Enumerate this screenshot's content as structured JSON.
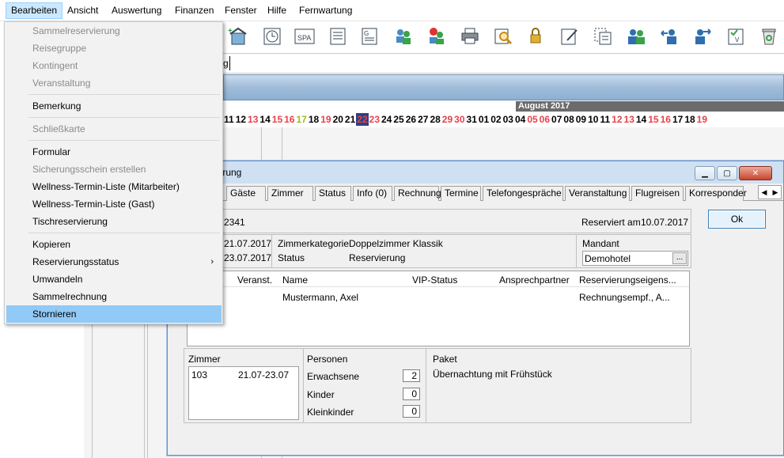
{
  "menubar": {
    "items": [
      "Bearbeiten",
      "Ansicht",
      "Auswertung",
      "Finanzen",
      "Fenster",
      "Hilfe",
      "Fernwartung"
    ]
  },
  "toolbar": {
    "spa_label": "SPA"
  },
  "addr": {
    "value": "g"
  },
  "calendar": {
    "month": "August 2017",
    "days": [
      "11",
      "12",
      "13",
      "14",
      "15",
      "16",
      "17",
      "18",
      "19",
      "20",
      "21",
      "22",
      "23",
      "24",
      "25",
      "26",
      "27",
      "28",
      "29",
      "30",
      "31",
      "01",
      "02",
      "03",
      "04",
      "05",
      "06",
      "07",
      "08",
      "09",
      "10",
      "11",
      "12",
      "13",
      "14",
      "15",
      "16",
      "17",
      "18",
      "19"
    ]
  },
  "context_menu": {
    "items": [
      {
        "label": "Sammelreservierung",
        "disabled": true
      },
      {
        "label": "Reisegruppe",
        "disabled": true
      },
      {
        "label": "Kontingent",
        "disabled": true
      },
      {
        "label": "Veranstaltung",
        "disabled": true
      },
      {
        "label": "Bemerkung",
        "disabled": false
      },
      {
        "label": "Schließkarte",
        "disabled": true
      },
      {
        "label": "Formular",
        "disabled": false
      },
      {
        "label": "Sicherungsschein erstellen",
        "disabled": true
      },
      {
        "label": "Wellness-Termin-Liste (Mitarbeiter)",
        "disabled": false
      },
      {
        "label": "Wellness-Termin-Liste (Gast)",
        "disabled": false
      },
      {
        "label": "Tischreservierung",
        "disabled": false
      },
      {
        "label": "Kopieren",
        "disabled": false
      },
      {
        "label": "Reservierungsstatus",
        "disabled": false,
        "submenu": true
      },
      {
        "label": "Umwandeln",
        "disabled": false
      },
      {
        "label": "Sammelrechnung",
        "disabled": false
      },
      {
        "label": "Stornieren",
        "disabled": false,
        "selected": true
      }
    ],
    "submenu_arrow": "›"
  },
  "dialog": {
    "title": "ierung",
    "tabs": [
      "Gäste",
      "Zimmer",
      "Status",
      "Info (0)",
      "Rechnung",
      "Termine",
      "Telefongespräche",
      "Veranstaltung",
      "Flugreisen",
      "Korresponder"
    ],
    "res_number": "2341",
    "reserved_label": "Reserviert am",
    "reserved_date": "10.07.2017",
    "ok_label": "Ok",
    "date_from": "21.07.2017",
    "date_to": "23.07.2017",
    "zimmerkategorie_label": "Zimmerkategorie",
    "zimmerkategorie_value": "Doppelzimmer Klassik",
    "status_label": "Status",
    "status_value": "Reservierung",
    "mandant_label": "Mandant",
    "mandant_value": "Demohotel",
    "mandant_btn": "...",
    "guest_table": {
      "headers": [
        "Veranst.",
        "Name",
        "VIP-Status",
        "Ansprechpartner",
        "Reservierungseigens..."
      ],
      "rows": [
        [
          "",
          "Mustermann, Axel",
          "",
          "",
          "Rechnungsempf., A..."
        ]
      ]
    },
    "zimmer_label": "Zimmer",
    "zimmer_row": {
      "nr": "103",
      "range": "21.07-23.07"
    },
    "personen_label": "Personen",
    "erwachsene_label": "Erwachsene",
    "erwachsene_value": "2",
    "kinder_label": "Kinder",
    "kinder_value": "0",
    "kleinkinder_label": "Kleinkinder",
    "kleinkinder_value": "0",
    "paket_label": "Paket",
    "paket_value": "Übernachtung mit Frühstück"
  },
  "colors": {
    "weekend": "#e8414b",
    "today_bg": "#2e3f84",
    "holiday": "#9cbe22",
    "selected_menu": "#91c9f7"
  }
}
